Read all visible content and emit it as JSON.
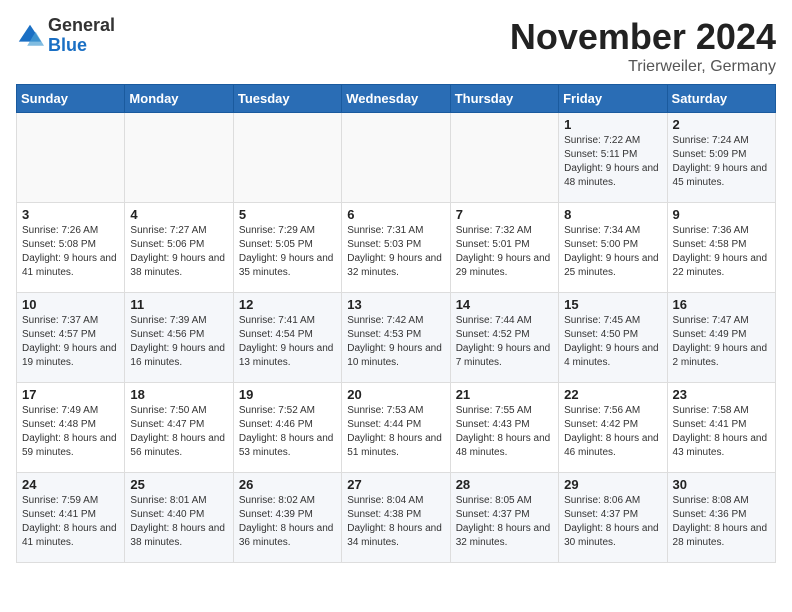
{
  "logo": {
    "general": "General",
    "blue": "Blue"
  },
  "title": "November 2024",
  "subtitle": "Trierweiler, Germany",
  "headers": [
    "Sunday",
    "Monday",
    "Tuesday",
    "Wednesday",
    "Thursday",
    "Friday",
    "Saturday"
  ],
  "weeks": [
    [
      {
        "day": "",
        "info": ""
      },
      {
        "day": "",
        "info": ""
      },
      {
        "day": "",
        "info": ""
      },
      {
        "day": "",
        "info": ""
      },
      {
        "day": "",
        "info": ""
      },
      {
        "day": "1",
        "info": "Sunrise: 7:22 AM\nSunset: 5:11 PM\nDaylight: 9 hours and 48 minutes."
      },
      {
        "day": "2",
        "info": "Sunrise: 7:24 AM\nSunset: 5:09 PM\nDaylight: 9 hours and 45 minutes."
      }
    ],
    [
      {
        "day": "3",
        "info": "Sunrise: 7:26 AM\nSunset: 5:08 PM\nDaylight: 9 hours and 41 minutes."
      },
      {
        "day": "4",
        "info": "Sunrise: 7:27 AM\nSunset: 5:06 PM\nDaylight: 9 hours and 38 minutes."
      },
      {
        "day": "5",
        "info": "Sunrise: 7:29 AM\nSunset: 5:05 PM\nDaylight: 9 hours and 35 minutes."
      },
      {
        "day": "6",
        "info": "Sunrise: 7:31 AM\nSunset: 5:03 PM\nDaylight: 9 hours and 32 minutes."
      },
      {
        "day": "7",
        "info": "Sunrise: 7:32 AM\nSunset: 5:01 PM\nDaylight: 9 hours and 29 minutes."
      },
      {
        "day": "8",
        "info": "Sunrise: 7:34 AM\nSunset: 5:00 PM\nDaylight: 9 hours and 25 minutes."
      },
      {
        "day": "9",
        "info": "Sunrise: 7:36 AM\nSunset: 4:58 PM\nDaylight: 9 hours and 22 minutes."
      }
    ],
    [
      {
        "day": "10",
        "info": "Sunrise: 7:37 AM\nSunset: 4:57 PM\nDaylight: 9 hours and 19 minutes."
      },
      {
        "day": "11",
        "info": "Sunrise: 7:39 AM\nSunset: 4:56 PM\nDaylight: 9 hours and 16 minutes."
      },
      {
        "day": "12",
        "info": "Sunrise: 7:41 AM\nSunset: 4:54 PM\nDaylight: 9 hours and 13 minutes."
      },
      {
        "day": "13",
        "info": "Sunrise: 7:42 AM\nSunset: 4:53 PM\nDaylight: 9 hours and 10 minutes."
      },
      {
        "day": "14",
        "info": "Sunrise: 7:44 AM\nSunset: 4:52 PM\nDaylight: 9 hours and 7 minutes."
      },
      {
        "day": "15",
        "info": "Sunrise: 7:45 AM\nSunset: 4:50 PM\nDaylight: 9 hours and 4 minutes."
      },
      {
        "day": "16",
        "info": "Sunrise: 7:47 AM\nSunset: 4:49 PM\nDaylight: 9 hours and 2 minutes."
      }
    ],
    [
      {
        "day": "17",
        "info": "Sunrise: 7:49 AM\nSunset: 4:48 PM\nDaylight: 8 hours and 59 minutes."
      },
      {
        "day": "18",
        "info": "Sunrise: 7:50 AM\nSunset: 4:47 PM\nDaylight: 8 hours and 56 minutes."
      },
      {
        "day": "19",
        "info": "Sunrise: 7:52 AM\nSunset: 4:46 PM\nDaylight: 8 hours and 53 minutes."
      },
      {
        "day": "20",
        "info": "Sunrise: 7:53 AM\nSunset: 4:44 PM\nDaylight: 8 hours and 51 minutes."
      },
      {
        "day": "21",
        "info": "Sunrise: 7:55 AM\nSunset: 4:43 PM\nDaylight: 8 hours and 48 minutes."
      },
      {
        "day": "22",
        "info": "Sunrise: 7:56 AM\nSunset: 4:42 PM\nDaylight: 8 hours and 46 minutes."
      },
      {
        "day": "23",
        "info": "Sunrise: 7:58 AM\nSunset: 4:41 PM\nDaylight: 8 hours and 43 minutes."
      }
    ],
    [
      {
        "day": "24",
        "info": "Sunrise: 7:59 AM\nSunset: 4:41 PM\nDaylight: 8 hours and 41 minutes."
      },
      {
        "day": "25",
        "info": "Sunrise: 8:01 AM\nSunset: 4:40 PM\nDaylight: 8 hours and 38 minutes."
      },
      {
        "day": "26",
        "info": "Sunrise: 8:02 AM\nSunset: 4:39 PM\nDaylight: 8 hours and 36 minutes."
      },
      {
        "day": "27",
        "info": "Sunrise: 8:04 AM\nSunset: 4:38 PM\nDaylight: 8 hours and 34 minutes."
      },
      {
        "day": "28",
        "info": "Sunrise: 8:05 AM\nSunset: 4:37 PM\nDaylight: 8 hours and 32 minutes."
      },
      {
        "day": "29",
        "info": "Sunrise: 8:06 AM\nSunset: 4:37 PM\nDaylight: 8 hours and 30 minutes."
      },
      {
        "day": "30",
        "info": "Sunrise: 8:08 AM\nSunset: 4:36 PM\nDaylight: 8 hours and 28 minutes."
      }
    ]
  ]
}
